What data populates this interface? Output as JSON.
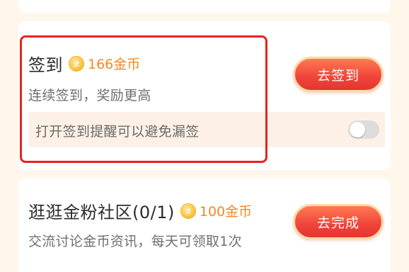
{
  "signin": {
    "title": "签到",
    "coin_symbol": "≢",
    "reward": "166金币",
    "description": "连续签到，奖励更高",
    "button_label": "去签到",
    "reminder_text": "打开签到提醒可以避免漏签",
    "reminder_enabled": false
  },
  "task": {
    "title": "逛逛金粉社区(0/1)",
    "coin_symbol": "≢",
    "reward": "100金币",
    "description": "交流讨论金币资讯，每天可领取1次",
    "button_label": "去完成"
  },
  "colors": {
    "accent_red": "#f0433a",
    "reward_orange": "#f08a24",
    "highlight_border": "#e8231f",
    "page_background": "#fff7ec"
  }
}
